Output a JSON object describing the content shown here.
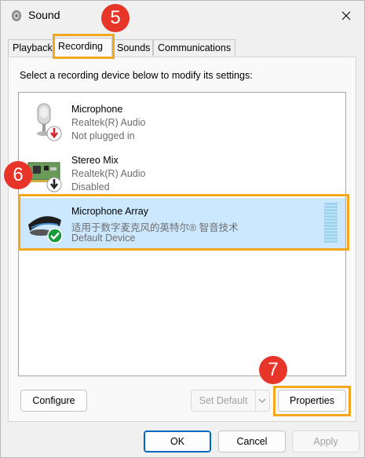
{
  "window": {
    "title": "Sound"
  },
  "tabs": [
    {
      "label": "Playback"
    },
    {
      "label": "Recording"
    },
    {
      "label": "Sounds"
    },
    {
      "label": "Communications"
    }
  ],
  "instruction": "Select a recording device below to modify its settings:",
  "devices": [
    {
      "name": "Microphone",
      "driver": "Realtek(R) Audio",
      "status": "Not plugged in",
      "icon": "microphone-icon",
      "state_icon": "red-down-arrow-icon"
    },
    {
      "name": "Stereo Mix",
      "driver": "Realtek(R) Audio",
      "status": "Disabled",
      "icon": "sound-card-icon",
      "state_icon": "black-down-arrow-icon"
    },
    {
      "name": "Microphone Array",
      "driver": "适用于数字麦克风的英特尔® 智音技术",
      "status": "Default Device",
      "icon": "microphone-array-icon",
      "state_icon": "green-check-icon",
      "selected": true
    }
  ],
  "buttons": {
    "configure": "Configure",
    "set_default": "Set Default",
    "properties": "Properties",
    "ok": "OK",
    "cancel": "Cancel",
    "apply": "Apply"
  },
  "annotations": {
    "step5": "5",
    "step6": "6",
    "step7": "7",
    "badge_color": "#e8352a",
    "highlight_color": "#f2a81d"
  },
  "colors": {
    "selection": "#cce8ff",
    "primary_border": "#0067c0"
  }
}
